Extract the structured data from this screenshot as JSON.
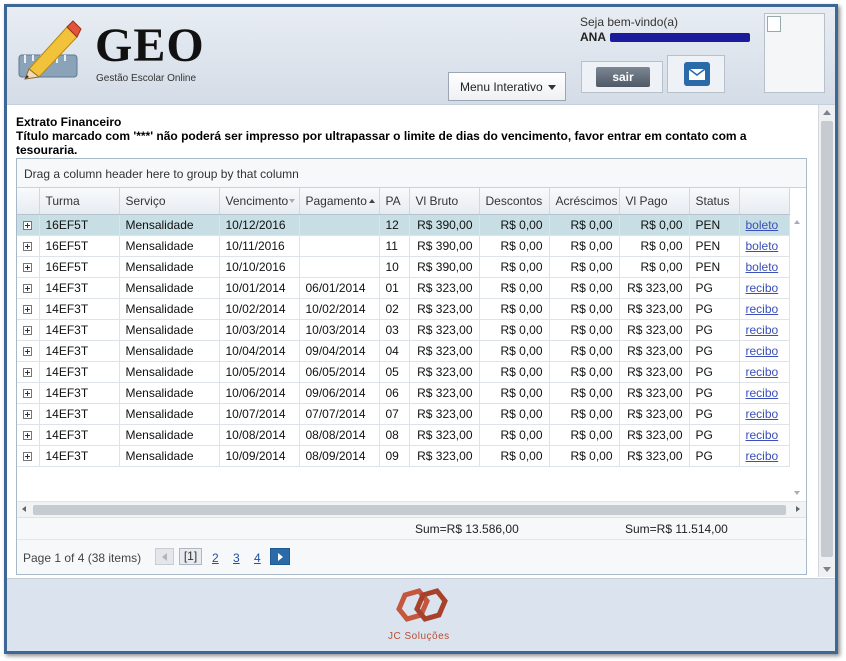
{
  "header": {
    "app_title": "GEO",
    "app_subtitle": "Gestão Escolar Online",
    "menu_label": "Menu Interativo",
    "welcome": "Seja bem-vindo(a)",
    "user_name": "ANA",
    "logout_label": "sair"
  },
  "main": {
    "title": "Extrato Financeiro",
    "notice": "Título marcado com '***' não poderá ser impresso por ultrapassar o limite de dias do vencimento, favor entrar em contato com a tesouraria."
  },
  "grid": {
    "group_hint": "Drag a column header here to group by that column",
    "columns": [
      "Turma",
      "Serviço",
      "Vencimento",
      "Pagamento",
      "PA",
      "Vl Bruto",
      "Descontos",
      "Acréscimos",
      "Vl Pago",
      "Status"
    ],
    "rows": [
      {
        "turma": "16EF5T",
        "servico": "Mensalidade",
        "vencimento": "10/12/2016",
        "pagamento": "",
        "pa": "12",
        "bruto": "R$ 390,00",
        "descontos": "R$ 0,00",
        "acrescimos": "R$ 0,00",
        "pago": "R$ 0,00",
        "status": "PEN",
        "link": "boleto"
      },
      {
        "turma": "16EF5T",
        "servico": "Mensalidade",
        "vencimento": "10/11/2016",
        "pagamento": "",
        "pa": "11",
        "bruto": "R$ 390,00",
        "descontos": "R$ 0,00",
        "acrescimos": "R$ 0,00",
        "pago": "R$ 0,00",
        "status": "PEN",
        "link": "boleto"
      },
      {
        "turma": "16EF5T",
        "servico": "Mensalidade",
        "vencimento": "10/10/2016",
        "pagamento": "",
        "pa": "10",
        "bruto": "R$ 390,00",
        "descontos": "R$ 0,00",
        "acrescimos": "R$ 0,00",
        "pago": "R$ 0,00",
        "status": "PEN",
        "link": "boleto"
      },
      {
        "turma": "14EF3T",
        "servico": "Mensalidade",
        "vencimento": "10/01/2014",
        "pagamento": "06/01/2014",
        "pa": "01",
        "bruto": "R$ 323,00",
        "descontos": "R$ 0,00",
        "acrescimos": "R$ 0,00",
        "pago": "R$ 323,00",
        "status": "PG",
        "link": "recibo"
      },
      {
        "turma": "14EF3T",
        "servico": "Mensalidade",
        "vencimento": "10/02/2014",
        "pagamento": "10/02/2014",
        "pa": "02",
        "bruto": "R$ 323,00",
        "descontos": "R$ 0,00",
        "acrescimos": "R$ 0,00",
        "pago": "R$ 323,00",
        "status": "PG",
        "link": "recibo"
      },
      {
        "turma": "14EF3T",
        "servico": "Mensalidade",
        "vencimento": "10/03/2014",
        "pagamento": "10/03/2014",
        "pa": "03",
        "bruto": "R$ 323,00",
        "descontos": "R$ 0,00",
        "acrescimos": "R$ 0,00",
        "pago": "R$ 323,00",
        "status": "PG",
        "link": "recibo"
      },
      {
        "turma": "14EF3T",
        "servico": "Mensalidade",
        "vencimento": "10/04/2014",
        "pagamento": "09/04/2014",
        "pa": "04",
        "bruto": "R$ 323,00",
        "descontos": "R$ 0,00",
        "acrescimos": "R$ 0,00",
        "pago": "R$ 323,00",
        "status": "PG",
        "link": "recibo"
      },
      {
        "turma": "14EF3T",
        "servico": "Mensalidade",
        "vencimento": "10/05/2014",
        "pagamento": "06/05/2014",
        "pa": "05",
        "bruto": "R$ 323,00",
        "descontos": "R$ 0,00",
        "acrescimos": "R$ 0,00",
        "pago": "R$ 323,00",
        "status": "PG",
        "link": "recibo"
      },
      {
        "turma": "14EF3T",
        "servico": "Mensalidade",
        "vencimento": "10/06/2014",
        "pagamento": "09/06/2014",
        "pa": "06",
        "bruto": "R$ 323,00",
        "descontos": "R$ 0,00",
        "acrescimos": "R$ 0,00",
        "pago": "R$ 323,00",
        "status": "PG",
        "link": "recibo"
      },
      {
        "turma": "14EF3T",
        "servico": "Mensalidade",
        "vencimento": "10/07/2014",
        "pagamento": "07/07/2014",
        "pa": "07",
        "bruto": "R$ 323,00",
        "descontos": "R$ 0,00",
        "acrescimos": "R$ 0,00",
        "pago": "R$ 323,00",
        "status": "PG",
        "link": "recibo"
      },
      {
        "turma": "14EF3T",
        "servico": "Mensalidade",
        "vencimento": "10/08/2014",
        "pagamento": "08/08/2014",
        "pa": "08",
        "bruto": "R$ 323,00",
        "descontos": "R$ 0,00",
        "acrescimos": "R$ 0,00",
        "pago": "R$ 323,00",
        "status": "PG",
        "link": "recibo"
      },
      {
        "turma": "14EF3T",
        "servico": "Mensalidade",
        "vencimento": "10/09/2014",
        "pagamento": "08/09/2014",
        "pa": "09",
        "bruto": "R$ 323,00",
        "descontos": "R$ 0,00",
        "acrescimos": "R$ 0,00",
        "pago": "R$ 323,00",
        "status": "PG",
        "link": "recibo"
      }
    ],
    "sum_bruto": "Sum=R$ 13.586,00",
    "sum_pago": "Sum=R$ 11.514,00",
    "pager_summary": "Page 1 of 4 (38 items)",
    "pager_current": "[1]",
    "pager_pages": [
      "2",
      "3",
      "4"
    ]
  },
  "footer": {
    "brand": "JC Soluções"
  },
  "colors": {
    "frame_border": "#3e6796",
    "selected_row": "#c7dfe4",
    "link": "#3a4fb8",
    "pager_next": "#2a6aa8",
    "brand": "#b94e33"
  },
  "icons": {
    "app_logo": "pencil-ruler-icon",
    "menu_caret": "chevron-down-icon",
    "mail": "mail-icon",
    "expand": "plus-box-icon",
    "sort": "sort-arrow-icon",
    "brand_logo": "jc-hexagon-logo"
  }
}
